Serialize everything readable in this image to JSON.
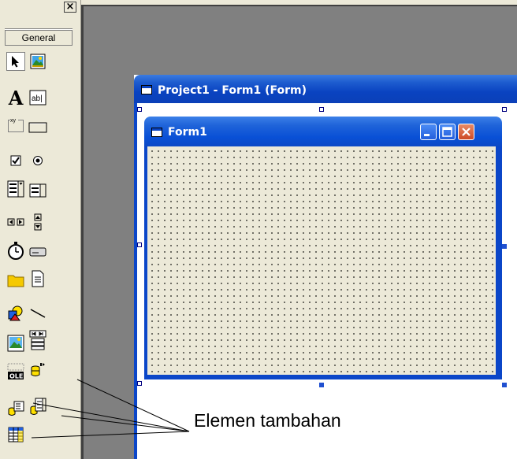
{
  "toolbox": {
    "close_label": "×",
    "tab_label": "General",
    "tools": [
      {
        "name": "pointer-icon"
      },
      {
        "name": "picturebox-icon"
      },
      {
        "name": "label-icon",
        "text": "A"
      },
      {
        "name": "textbox-icon",
        "text": "ab|"
      },
      {
        "name": "frame-icon",
        "text": "xy"
      },
      {
        "name": "commandbutton-icon"
      },
      {
        "name": "checkbox-icon"
      },
      {
        "name": "optionbutton-icon"
      },
      {
        "name": "combobox-icon"
      },
      {
        "name": "listbox-icon"
      },
      {
        "name": "hscrollbar-icon"
      },
      {
        "name": "vscrollbar-icon"
      },
      {
        "name": "timer-icon"
      },
      {
        "name": "drivelistbox-icon"
      },
      {
        "name": "dirlistbox-icon"
      },
      {
        "name": "filelistbox-icon"
      },
      {
        "name": "shape-icon"
      },
      {
        "name": "line-icon"
      },
      {
        "name": "image-icon"
      },
      {
        "name": "data-icon"
      },
      {
        "name": "ole-icon",
        "text": "OLE"
      },
      {
        "name": "adodc-icon"
      },
      {
        "name": "datalist-icon"
      },
      {
        "name": "datacombo-icon"
      },
      {
        "name": "datagrid-icon"
      }
    ]
  },
  "designer": {
    "title": "Project1 - Form1 (Form)"
  },
  "form": {
    "title": "Form1"
  },
  "annotation": {
    "text": "Elemen tambahan"
  },
  "colors": {
    "xp_blue": "#0b46c8",
    "form_client": "#ece9d8",
    "workspace": "#808080"
  }
}
